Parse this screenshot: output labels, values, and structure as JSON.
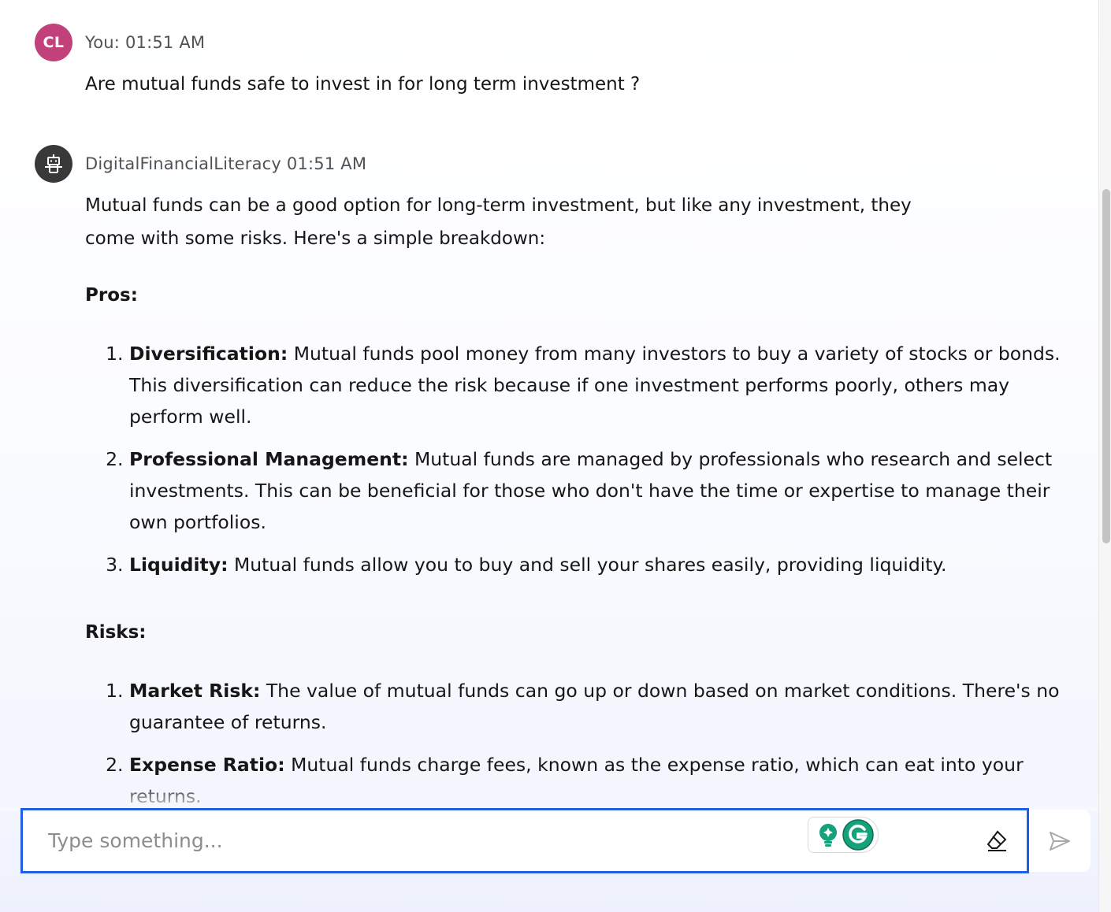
{
  "user_message": {
    "avatar_initials": "CL",
    "meta": "You: 01:51 AM",
    "text": "Are mutual funds safe to invest in for long term investment ?"
  },
  "bot_message": {
    "avatar_icon": "robot-icon",
    "meta": "DigitalFinancialLiteracy 01:51 AM",
    "intro_line1": "Mutual funds can be a good option for long-term investment, but like any investment, they",
    "intro_line2": "come with some risks. Here's a simple breakdown:",
    "pros_heading": "Pros:",
    "pros": [
      {
        "title": "Diversification:",
        "text": " Mutual funds pool money from many investors to buy a variety of stocks or bonds. This diversification can reduce the risk because if one investment performs poorly, others may perform well."
      },
      {
        "title": "Professional Management:",
        "text": " Mutual funds are managed by professionals who research and select investments. This can be beneficial for those who don't have the time or expertise to manage their own portfolios."
      },
      {
        "title": "Liquidity:",
        "text": " Mutual funds allow you to buy and sell your shares easily, providing liquidity."
      }
    ],
    "risks_heading": "Risks:",
    "risks": [
      {
        "title": "Market Risk:",
        "text": " The value of mutual funds can go up or down based on market conditions. There's no guarantee of returns."
      },
      {
        "title": "Expense Ratio:",
        "text": " Mutual funds charge fees, known as the expense ratio, which can eat into your returns."
      }
    ]
  },
  "composer": {
    "placeholder": "Type something...",
    "value": ""
  },
  "icons": {
    "clear": "eraser-icon",
    "send": "send-icon",
    "grammarly": "grammarly-icon"
  },
  "colors": {
    "user_avatar": "#c2417a",
    "bot_avatar": "#393939",
    "focus_border": "#1f5ee6",
    "grammarly_green": "#15a17b"
  }
}
